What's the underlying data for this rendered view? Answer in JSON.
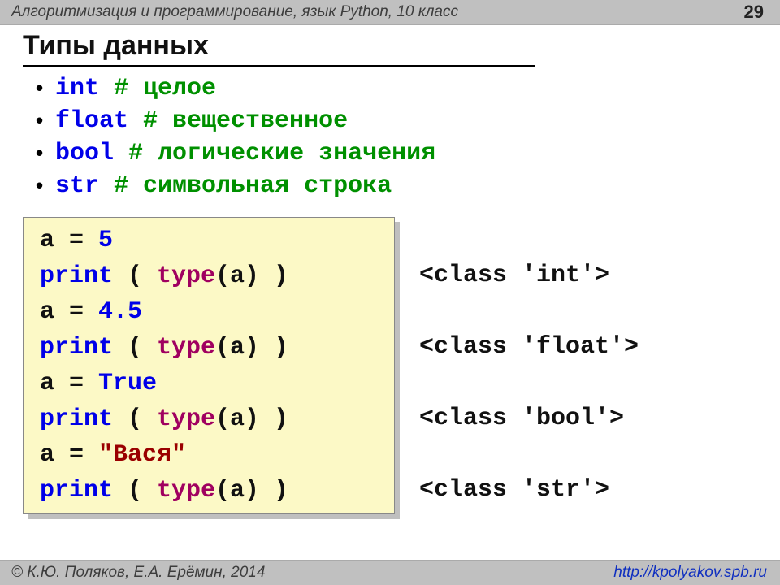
{
  "header": {
    "course": "Алгоритмизация и программирование, язык Python, 10 класс",
    "page": "29"
  },
  "title": "Типы данных",
  "types": [
    {
      "kw": "int",
      "pad": "    ",
      "comment": "# целое"
    },
    {
      "kw": "float",
      "pad": "  ",
      "comment": "# вещественное"
    },
    {
      "kw": "bool",
      "pad": "     ",
      "comment": "# логические значения"
    },
    {
      "kw": "str",
      "pad": "  ",
      "comment": "# символьная строка"
    }
  ],
  "code": {
    "l1a": "a",
    "l1b": " = ",
    "l1c": "5",
    "l2a": "print",
    "l2b": " ( ",
    "l2c": "type",
    "l2d": "(a) )",
    "l3a": "a",
    "l3b": " = ",
    "l3c": "4.5",
    "l4a": "print",
    "l4b": " ( ",
    "l4c": "type",
    "l4d": "(a) )",
    "l5a": "a",
    "l5b": " = ",
    "l5c": "True",
    "l6a": "print",
    "l6b": " ( ",
    "l6c": "type",
    "l6d": "(a) )",
    "l7a": "a",
    "l7b": " = ",
    "l7c": "\"Вася\"",
    "l8a": "print",
    "l8b": " ( ",
    "l8c": "type",
    "l8d": "(a) )"
  },
  "outputs": [
    "",
    "<class 'int'>",
    "",
    "<class 'float'>",
    "",
    "<class 'bool'>",
    "",
    "<class 'str'>"
  ],
  "footer": {
    "authors": "© К.Ю. Поляков, Е.А. Ерёмин, 2014",
    "url": "http://kpolyakov.spb.ru"
  }
}
